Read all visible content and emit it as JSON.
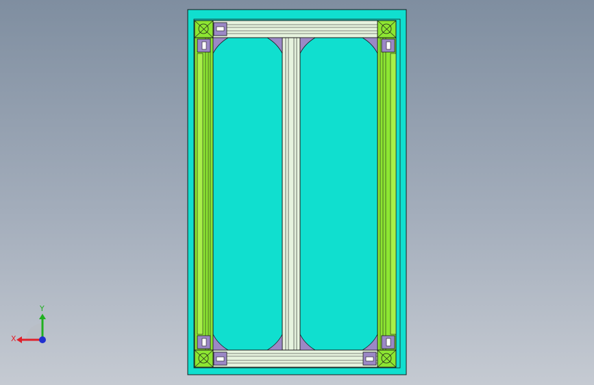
{
  "viewport": {
    "background_top": "#7f8ea0",
    "background_bottom": "#c5cad2"
  },
  "model": {
    "panel_color": "#10dfcf",
    "frame_color": "#e6f3de",
    "upright_color": "#8de632",
    "bracket_color": "#9b88c6",
    "outline_color": "#1a1a1a"
  },
  "triad": {
    "x_label": "X",
    "y_label": "Y",
    "x_color": "#e0202a",
    "y_color": "#20b020",
    "z_color": "#2030d0"
  }
}
